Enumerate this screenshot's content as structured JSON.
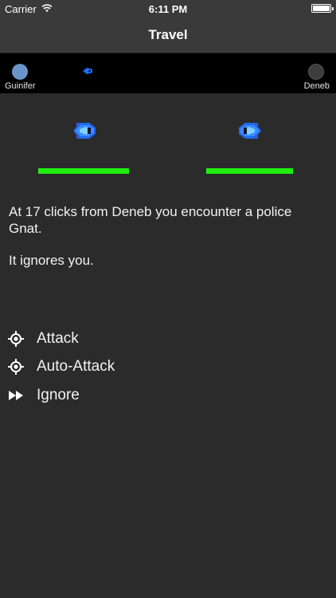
{
  "status_bar": {
    "carrier": "Carrier",
    "time": "6:11 PM"
  },
  "nav": {
    "title": "Travel"
  },
  "travel": {
    "origin": "Guinifer",
    "destination": "Deneb",
    "origin_color": "#6a95c8",
    "destination_color": "#3d3d3d"
  },
  "encounter": {
    "player_hull_fraction": 1.0,
    "opponent_hull_fraction": 1.0,
    "hull_color": "#20ee10",
    "message": "At 17 clicks from Deneb you encounter a police Gnat.",
    "response": "It ignores you."
  },
  "actions": [
    {
      "label": "Attack",
      "icon": "crosshair-icon"
    },
    {
      "label": "Auto-Attack",
      "icon": "crosshair-icon"
    },
    {
      "label": "Ignore",
      "icon": "fast-forward-icon"
    }
  ]
}
